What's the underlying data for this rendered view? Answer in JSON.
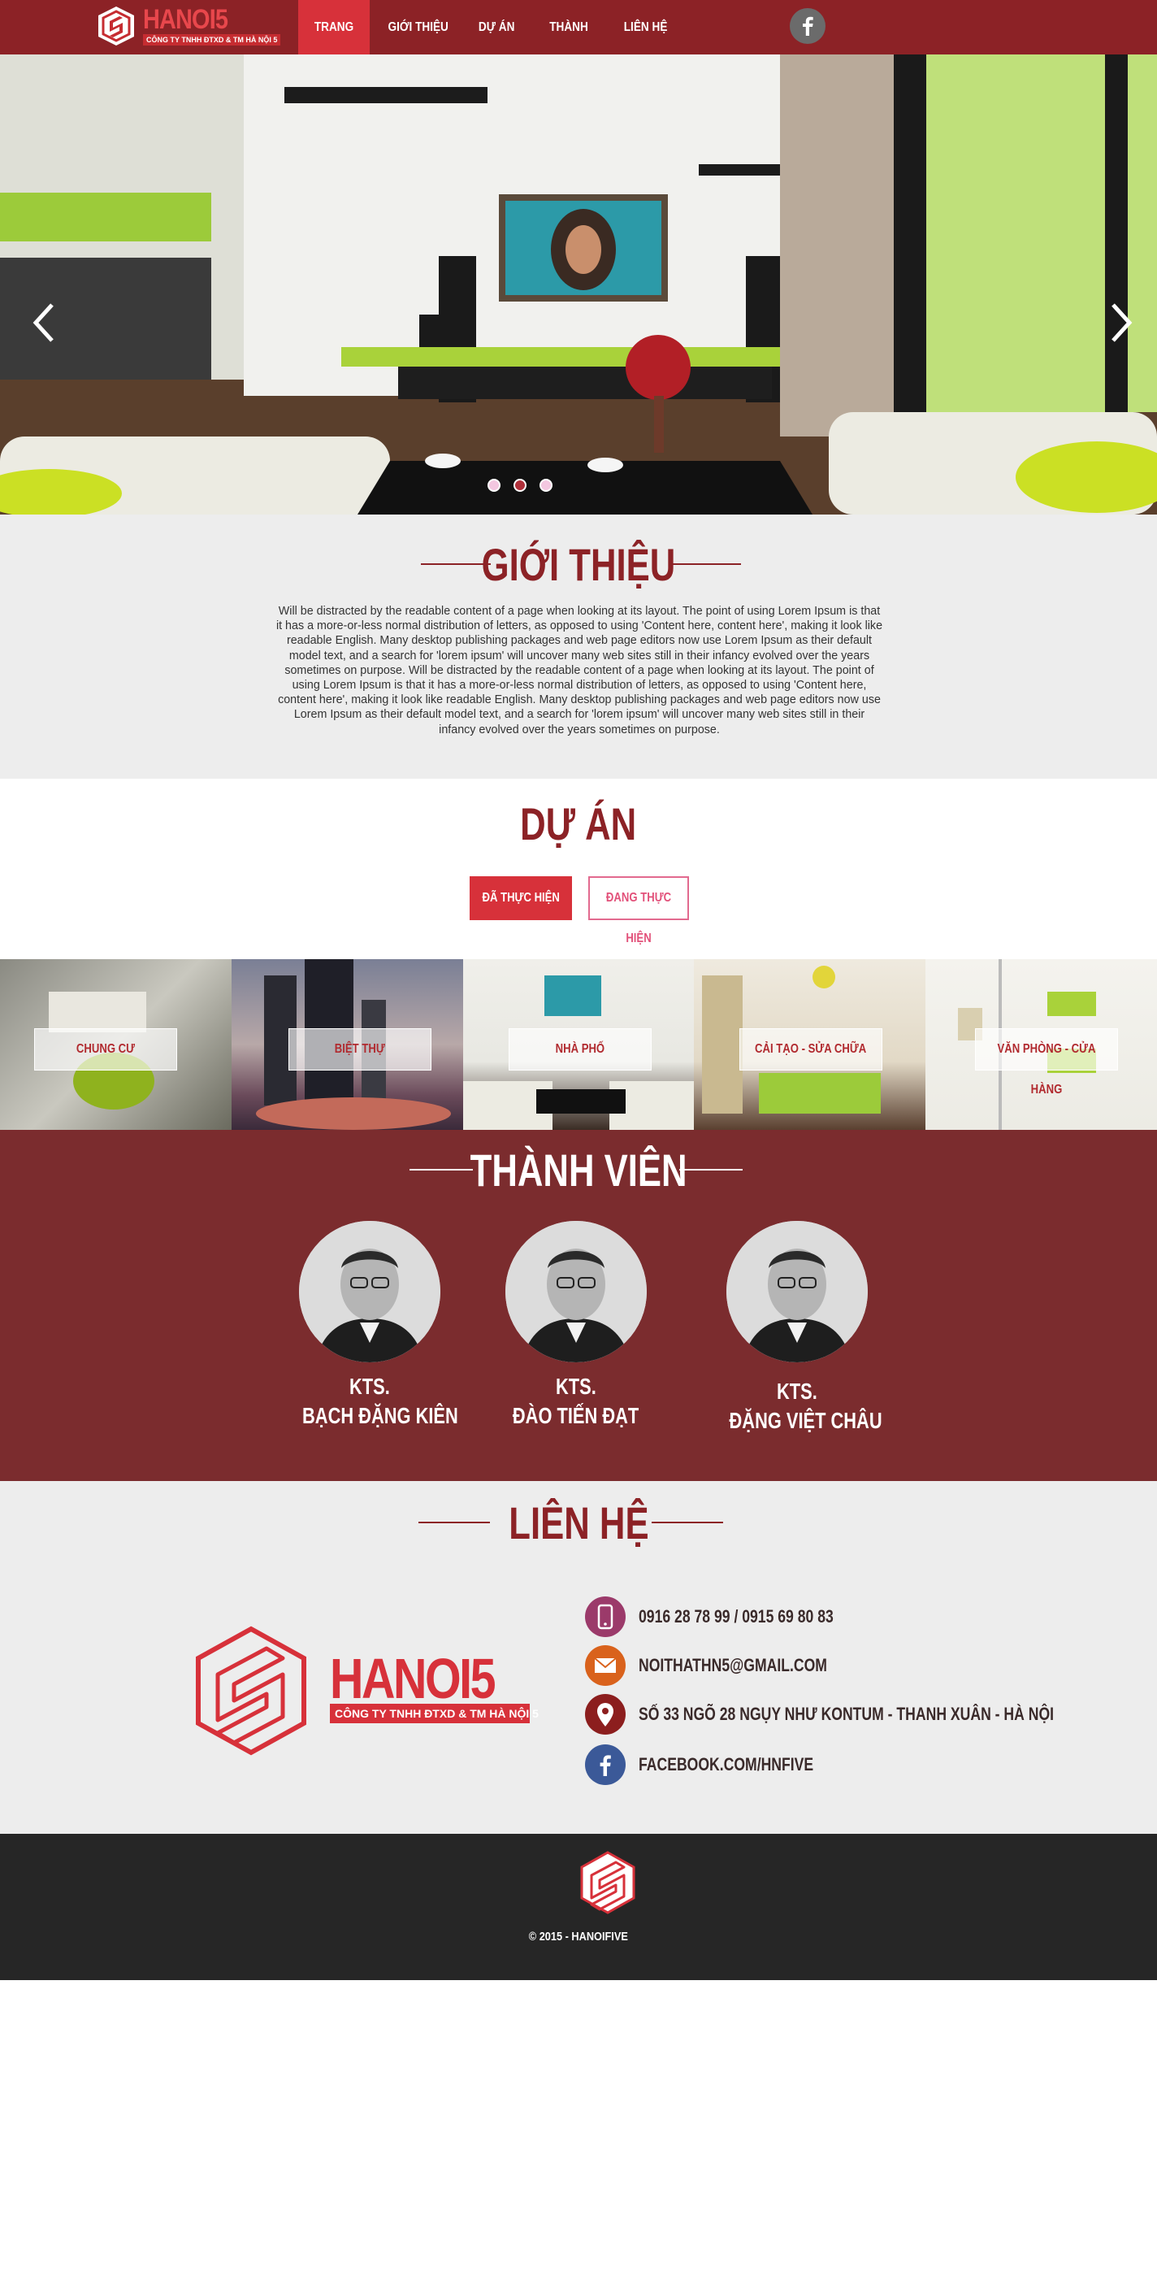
{
  "colors": {
    "brand": "#8c2226",
    "accent": "#d7313a",
    "team_bg": "#7b2c2e",
    "footer_bg": "#262626",
    "section_bg": "#ededed"
  },
  "brand": {
    "wordmark": "HANOI5",
    "tagline": "CÔNG TY TNHH ĐTXD & TM HÀ NỘI 5"
  },
  "nav": {
    "items": [
      {
        "label": "TRANG CHỦ",
        "active": true
      },
      {
        "label": "GIỚI THIỆU",
        "active": false
      },
      {
        "label": "DỰ ÁN",
        "active": false
      },
      {
        "label": "THÀNH VIÊN",
        "active": false
      },
      {
        "label": "LIÊN HỆ",
        "active": false
      }
    ],
    "social_icon": "facebook-icon"
  },
  "hero": {
    "prev_icon": "chevron-left-icon",
    "next_icon": "chevron-right-icon",
    "slide_count": 3,
    "active_slide": 2
  },
  "intro": {
    "title": "GIỚI THIỆU",
    "body": "Will be distracted by the readable content of a page when looking at its layout. The point of using Lorem Ipsum is that it has a more-or-less normal distribution of letters, as opposed to using 'Content here, content here', making it look like readable English. Many desktop publishing packages and web page editors now use Lorem Ipsum as their default model text, and a search for 'lorem ipsum' will uncover many web sites still in their infancy evolved over the years sometimes on purpose. Will be distracted by the readable content of a page when looking at its layout. The point of using Lorem Ipsum is that it has a more-or-less normal distribution of letters, as opposed to using 'Content here, content here', making it look like readable English. Many desktop publishing packages and web page editors now use Lorem Ipsum as their default model text, and a search for 'lorem ipsum' will uncover many web sites still in their infancy evolved over the years sometimes on purpose."
  },
  "projects": {
    "title": "DỰ ÁN",
    "tabs": [
      {
        "label": "ĐÃ THỰC HIỆN",
        "active": true
      },
      {
        "label": "ĐANG THỰC HIỆN",
        "active": false
      }
    ],
    "categories": [
      "CHUNG CƯ",
      "BIỆT THỰ",
      "NHÀ PHỐ",
      "CẢI TẠO - SỬA CHỮA",
      "VĂN PHÒNG - CỬA HÀNG"
    ]
  },
  "team": {
    "title": "THÀNH VIÊN",
    "members": [
      {
        "prefix": "KTS.",
        "name": "BẠCH ĐẶNG KIÊN"
      },
      {
        "prefix": "KTS.",
        "name": "ĐÀO TIẾN ĐẠT"
      },
      {
        "prefix": "KTS.",
        "name": "ĐẶNG VIỆT CHÂU"
      }
    ]
  },
  "contact": {
    "title": "LIÊN HỆ",
    "items": [
      {
        "icon": "phone-icon",
        "color": "#9b3a6a",
        "text": "0916 28 78 99  /  0915 69 80 83"
      },
      {
        "icon": "email-icon",
        "color": "#d9621c",
        "text": "NOITHATHN5@GMAIL.COM"
      },
      {
        "icon": "location-icon",
        "color": "#8c1e1e",
        "text": "SỐ 33 NGÕ 28 NGỤY NHƯ KONTUM - THANH XUÂN - HÀ NỘI"
      },
      {
        "icon": "facebook-icon",
        "color": "#3b5998",
        "text": "FACEBOOK.COM/HNFIVE"
      }
    ]
  },
  "footer": {
    "copyright": "© 2015 -  HANOIFIVE"
  }
}
